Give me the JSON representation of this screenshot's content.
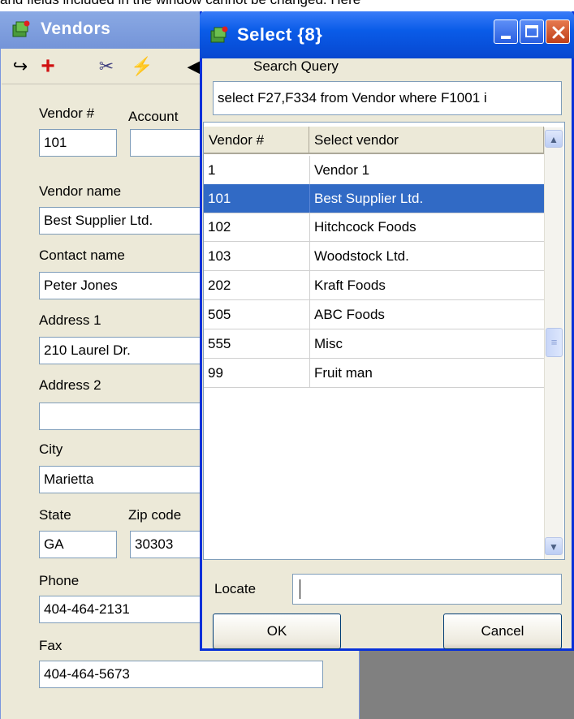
{
  "doc_text": "and fields included in the window cannot be changed. Here",
  "vendors_window": {
    "title": "Vendors",
    "toolbar": [
      {
        "name": "undo-icon",
        "glyph": "↪"
      },
      {
        "name": "add-icon",
        "glyph": "+"
      },
      {
        "name": "cut-icon",
        "glyph": "✂"
      },
      {
        "name": "wand-icon",
        "glyph": "⚡"
      },
      {
        "name": "nav-left-icon",
        "glyph": "◀"
      }
    ],
    "fields": {
      "vendor_num_label": "Vendor #",
      "vendor_num": "101",
      "account_label": "Account",
      "account": "",
      "vendor_name_label": "Vendor name",
      "vendor_name": "Best Supplier Ltd.",
      "contact_label": "Contact name",
      "contact": "Peter Jones",
      "address1_label": "Address 1",
      "address1": "210 Laurel Dr.",
      "address2_label": "Address 2",
      "address2": "",
      "city_label": "City",
      "city": "Marietta",
      "state_label": "State",
      "state": "GA",
      "zip_label": "Zip code",
      "zip": "30303",
      "phone_label": "Phone",
      "phone": "404-464-2131",
      "fax_label": "Fax",
      "fax": "404-464-5673"
    }
  },
  "select_dialog": {
    "title": "Select {8}",
    "search_label": "Search Query",
    "search_query": "select F27,F334 from Vendor where F1001 i",
    "columns": [
      "Vendor #",
      "Select vendor"
    ],
    "rows": [
      {
        "num": "1",
        "name": "Vendor 1"
      },
      {
        "num": "101",
        "name": "Best Supplier Ltd."
      },
      {
        "num": "102",
        "name": "Hitchcock Foods"
      },
      {
        "num": "103",
        "name": "Woodstock Ltd."
      },
      {
        "num": "202",
        "name": "Kraft Foods"
      },
      {
        "num": "505",
        "name": "ABC Foods"
      },
      {
        "num": "555",
        "name": "Misc"
      },
      {
        "num": "99",
        "name": "Fruit man"
      }
    ],
    "selected_row": 1,
    "locate_label": "Locate",
    "locate_value": "",
    "ok_label": "OK",
    "cancel_label": "Cancel"
  },
  "colors": {
    "title_bar": "#0a5ce8",
    "selection": "#316ac5",
    "window_bg": "#ece9d8",
    "desktop": "#808080"
  }
}
